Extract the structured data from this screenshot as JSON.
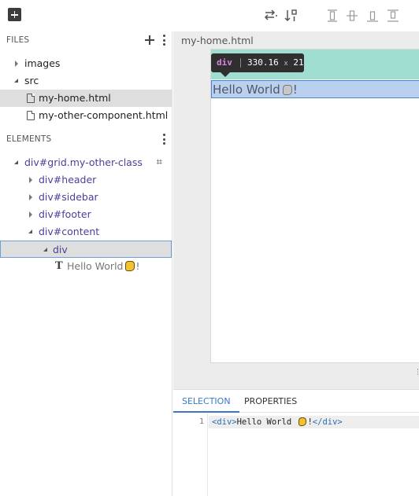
{
  "files_panel": {
    "title": "FILES",
    "items": [
      {
        "label": "images",
        "type": "folder"
      },
      {
        "label": "src",
        "type": "folder"
      },
      {
        "label": "my-home.html",
        "type": "file"
      },
      {
        "label": "my-other-component.html",
        "type": "file"
      }
    ]
  },
  "elements_panel": {
    "title": "ELEMENTS",
    "items": [
      {
        "label": "div#grid.my-other-class"
      },
      {
        "label": "div#header"
      },
      {
        "label": "div#sidebar"
      },
      {
        "label": "div#footer"
      },
      {
        "label": "div#content"
      },
      {
        "label": "div"
      },
      {
        "label": "Hello World",
        "suffix": "!"
      }
    ]
  },
  "canvas": {
    "document_tab": "my-home.html",
    "tooltip": {
      "tag": "div",
      "dims": "330.16",
      "x": "x",
      "h": "21"
    },
    "highlight_text": "Hello World",
    "highlight_suffix": "!"
  },
  "bottom_panel": {
    "tabs": [
      "SELECTION",
      "PROPERTIES"
    ],
    "code": {
      "line_number": "1",
      "open_tag": "<div>",
      "text": "Hello World ",
      "suffix": "!",
      "close_tag": "</div>"
    }
  },
  "colors": {
    "accent": "#3d78c8",
    "teal": "#9fded0",
    "highlight": "#b9d1ee",
    "element_label": "#4b3f9a"
  },
  "icons": [
    "add-icon",
    "arrange-icon",
    "sort-icon",
    "align-left-icon",
    "align-center-icon",
    "align-bottom-icon",
    "align-top-icon",
    "plus-icon",
    "kebab-icon",
    "grid-icon",
    "hand-emoji-icon"
  ]
}
